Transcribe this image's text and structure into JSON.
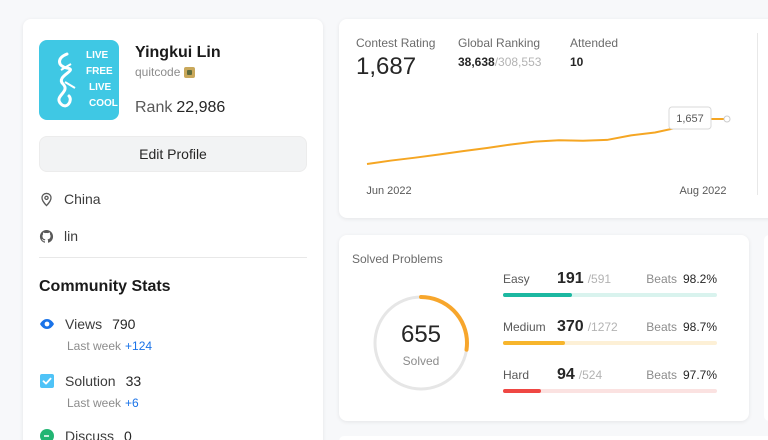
{
  "profile": {
    "name": "Yingkui Lin",
    "handle": "quitcode",
    "rank_label": "Rank",
    "rank_value": "22,986",
    "edit_button": "Edit Profile",
    "location": "China",
    "github": "lin",
    "avatar_text": [
      "LIVE",
      "FREE",
      "LIVE",
      "COOL"
    ]
  },
  "community": {
    "title": "Community Stats",
    "stats": [
      {
        "label": "Views",
        "value": "790",
        "sub_label": "Last week",
        "delta": "+124"
      },
      {
        "label": "Solution",
        "value": "33",
        "sub_label": "Last week",
        "delta": "+6"
      },
      {
        "label": "Discuss",
        "value": "0"
      }
    ]
  },
  "contest": {
    "rating_label": "Contest Rating",
    "rating_value": "1,687",
    "global_label": "Global Ranking",
    "global_value": "38,638",
    "global_total": "/308,553",
    "attended_label": "Attended",
    "attended_value": "10",
    "tooltip": "1,657"
  },
  "chart_data": {
    "type": "line",
    "x_ticks": [
      "Jun 2022",
      "Aug 2022"
    ],
    "values": [
      1500,
      1512,
      1522,
      1533,
      1545,
      1556,
      1568,
      1578,
      1583,
      1581,
      1584,
      1600,
      1610,
      1628,
      1657,
      1657
    ],
    "highlight_value": "1,657",
    "color": "#f5a623"
  },
  "solved": {
    "title": "Solved Problems",
    "total": "655",
    "total_label": "Solved",
    "total_count": 655,
    "beats_label": "Beats",
    "difficulties": [
      {
        "name": "Easy",
        "solved": "191",
        "total": "/591",
        "beats": "98.2%",
        "ratio": 0.323,
        "color": "#1cb8a1",
        "track": "#d9f3ee"
      },
      {
        "name": "Medium",
        "solved": "370",
        "total": "/1272",
        "beats": "98.7%",
        "ratio": 0.291,
        "color": "#f7b52c",
        "track": "#fdf0d6"
      },
      {
        "name": "Hard",
        "solved": "94",
        "total": "/524",
        "beats": "97.7%",
        "ratio": 0.179,
        "color": "#ef4743",
        "track": "#fbe2e1"
      }
    ],
    "ring_fraction": 0.273
  }
}
